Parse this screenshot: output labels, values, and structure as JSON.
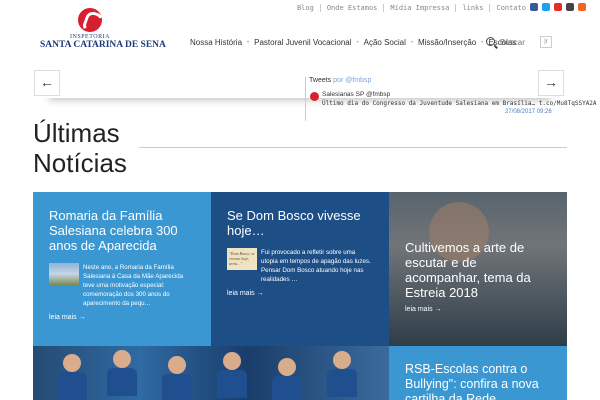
{
  "topbar": {
    "links": [
      "Blog",
      "Onde Estamos",
      "Mídia Impressa",
      "links",
      "Contato"
    ],
    "social": [
      "facebook-icon",
      "twitter-icon",
      "youtube-icon",
      "instagram-icon",
      "rss-icon"
    ]
  },
  "logo": {
    "line1": "INSPETORIA",
    "line2": "SANTA CATARINA DE SENA"
  },
  "nav": {
    "items": [
      "Nossa História",
      "Pastoral Juvenil Vocacional",
      "Ação Social",
      "Missão/Inserção",
      "Escolas"
    ],
    "search_placeholder": "Buscar",
    "lang": "|r"
  },
  "slider": {
    "prev": "←",
    "next": "→"
  },
  "tweets": {
    "title": "Tweets",
    "by": "por @fmbsp",
    "user": "Salesianas SP @fmbsp",
    "text": "Último dia do Congresso da Juventude Salesiana em Brasília… t.co/Mu8TqSSYA2A",
    "time": "27/08/2017 09:26"
  },
  "section": {
    "title_line1": "Últimas",
    "title_line2": "Notícias"
  },
  "cards": [
    {
      "title": "Romaria da Família Salesiana celebra 300 anos de Aparecida",
      "excerpt": "Neste ano, a Romaria da Família Salesiana à Casa da Mãe Aparecida teve uma motivação especial: comemoração dos 300 anos do aparecimento da pequ…",
      "more": "leia mais →"
    },
    {
      "title": "Se Dom Bosco vivesse hoje…",
      "excerpt": "Fui provocado a refletir sobre uma utopia em tempos de apagão das luzes. Pensar Dom Bosco atuando hoje nas realidades …",
      "thumb_text": "\"Dom Bosco, se vivesse hoje, seria…\"",
      "more": "leia mais →"
    },
    {
      "title": "Cultivemos a arte de escutar e de acompanhar, tema da Estreia 2018",
      "more": "leia mais →"
    },
    {
      "title": "RSB-Escolas contra o Bullying\": confira a nova cartilha da Rede"
    }
  ],
  "colors": {
    "card_light": "#3a97d1",
    "card_dark": "#1d4e86",
    "brand_red": "#d62030",
    "brand_blue": "#1e3a7a"
  }
}
